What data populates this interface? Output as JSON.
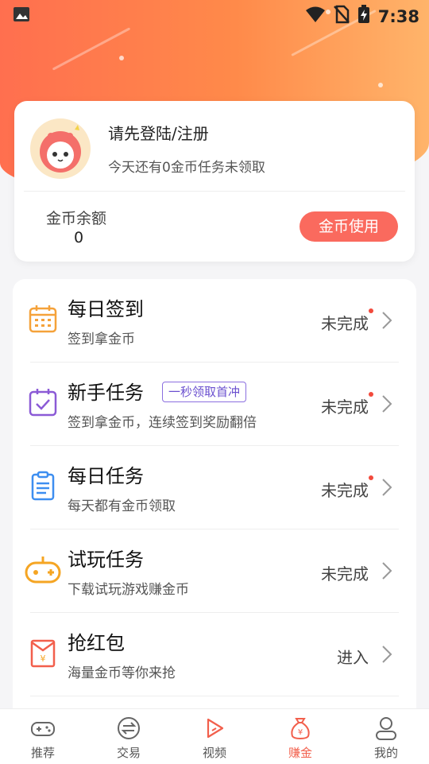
{
  "status_bar": {
    "time": "7:38"
  },
  "profile": {
    "login_title": "请先登陆/注册",
    "login_subtitle": "今天还有0金币任务未领取",
    "balance_label": "金币余额",
    "balance_value": "0",
    "use_button": "金币使用"
  },
  "tasks": [
    {
      "title": "每日签到",
      "subtitle": "签到拿金币",
      "status": "未完成",
      "icon": "calendar-icon",
      "dot": true
    },
    {
      "title": "新手任务",
      "subtitle": "签到拿金币，连续签到奖励翻倍",
      "status": "未完成",
      "icon": "checkbox-icon",
      "dot": true,
      "badge": "一秒领取首冲"
    },
    {
      "title": "每日任务",
      "subtitle": "每天都有金币领取",
      "status": "未完成",
      "icon": "clipboard-icon",
      "dot": true
    },
    {
      "title": "试玩任务",
      "subtitle": "下载试玩游戏赚金币",
      "status": "未完成",
      "icon": "gamepad-icon",
      "dot": false
    },
    {
      "title": "抢红包",
      "subtitle": "海量金币等你来抢",
      "status": "进入",
      "icon": "red-envelope-icon",
      "dot": false
    }
  ],
  "tabs": [
    {
      "label": "推荐",
      "icon": "gamepad-icon"
    },
    {
      "label": "交易",
      "icon": "exchange-icon"
    },
    {
      "label": "视频",
      "icon": "play-icon"
    },
    {
      "label": "赚金",
      "icon": "money-bag-icon",
      "active": true
    },
    {
      "label": "我的",
      "icon": "user-icon"
    }
  ],
  "colors": {
    "accent": "#fa6a5e",
    "badge": "#8b6fe0",
    "hero_start": "#ff6f4f",
    "hero_end": "#ffb46a"
  }
}
